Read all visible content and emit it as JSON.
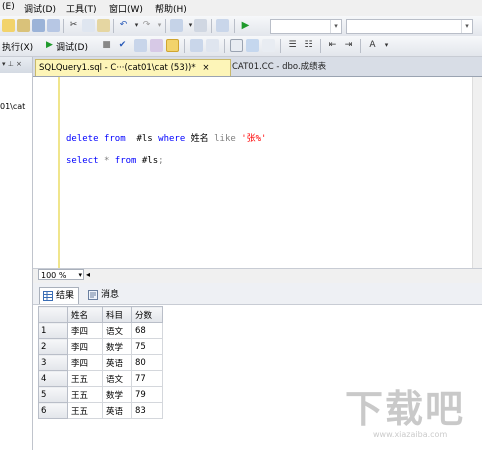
{
  "menu": [
    {
      "label": "(E)"
    },
    {
      "label": "调试(D)"
    },
    {
      "label": "工具(T)"
    },
    {
      "label": "窗口(W)"
    },
    {
      "label": "帮助(H)"
    }
  ],
  "toolbar2": {
    "execute_label": "执行(X)",
    "debug_label": "调试(D)"
  },
  "left_panel": {
    "pin": "▾ ⊥ ×",
    "server_text": "01\\cat"
  },
  "tabs": [
    {
      "label": "SQLQuery1.sql - C···(cat01\\cat (53))*",
      "active": true,
      "close": "×"
    },
    {
      "label": "CAT01.CC - dbo.成绩表",
      "active": false
    }
  ],
  "editor": {
    "line1": {
      "kw1": "delete",
      "kw2": "from",
      "t1": "#ls",
      "kw3": "where",
      "t2": "姓名",
      "kw4": "like",
      "str": "'张%'"
    },
    "line2": {
      "kw1": "select",
      "op": "*",
      "kw2": "from",
      "t1": "#ls",
      "end": ";"
    }
  },
  "zoom": {
    "value": "100 %"
  },
  "results_tabs": [
    {
      "label": "结果",
      "icon": "grid-icon"
    },
    {
      "label": "消息",
      "icon": "message-icon"
    }
  ],
  "grid": {
    "columns": [
      "姓名",
      "科目",
      "分数"
    ],
    "rows": [
      {
        "n": "1",
        "name": "李四",
        "subject": "语文",
        "score": "68"
      },
      {
        "n": "2",
        "name": "李四",
        "subject": "数学",
        "score": "75"
      },
      {
        "n": "3",
        "name": "李四",
        "subject": "英语",
        "score": "80"
      },
      {
        "n": "4",
        "name": "王五",
        "subject": "语文",
        "score": "77"
      },
      {
        "n": "5",
        "name": "王五",
        "subject": "数学",
        "score": "79"
      },
      {
        "n": "6",
        "name": "王五",
        "subject": "英语",
        "score": "83"
      }
    ]
  },
  "watermark": {
    "logo": "下载吧",
    "url": "www.xiazaiba.com"
  },
  "colors": {
    "keyword": "#0000ff",
    "string": "#ff0000",
    "active_tab": "#fdf5b8"
  }
}
